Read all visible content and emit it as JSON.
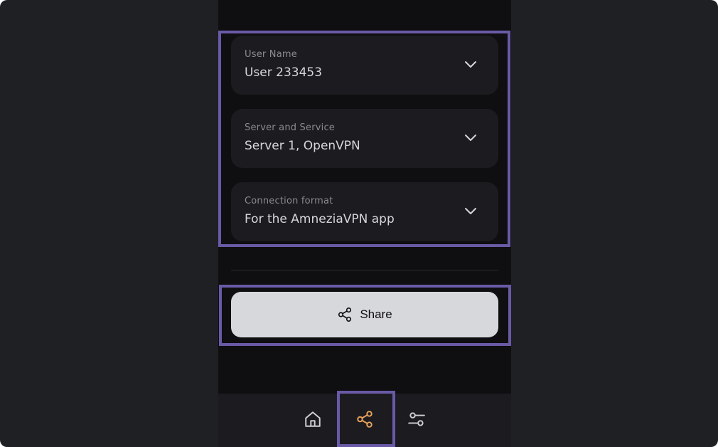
{
  "fields": [
    {
      "label": "User Name",
      "value": "User 233453"
    },
    {
      "label": "Server and Service",
      "value": "Server 1, OpenVPN"
    },
    {
      "label": "Connection format",
      "value": "For the AmneziaVPN app"
    }
  ],
  "share_button": {
    "label": "Share",
    "icon": "share-icon"
  },
  "tabbar": {
    "items": [
      {
        "icon": "home-icon",
        "active": false
      },
      {
        "icon": "share-icon",
        "active": true
      },
      {
        "icon": "settings-sliders-icon",
        "active": false
      }
    ],
    "active_color": "#e8a35a",
    "inactive_color": "#cfcfd4"
  },
  "colors": {
    "highlight": "#6a5aa6",
    "background": "#1f2024",
    "panel": "#0f0f11"
  }
}
